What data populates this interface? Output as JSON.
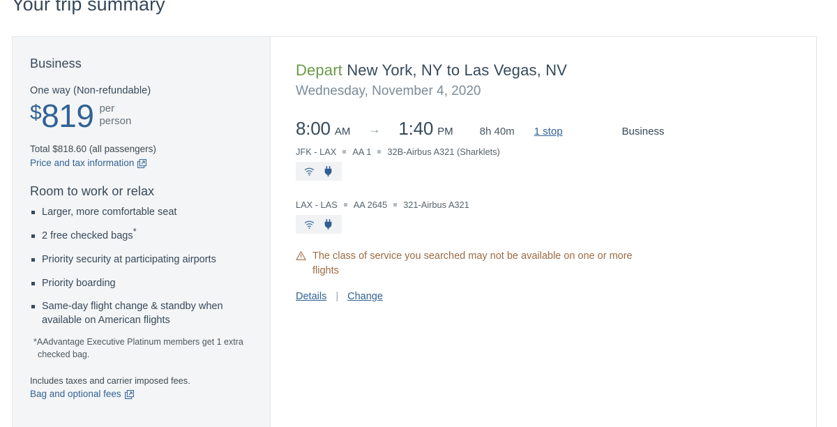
{
  "page": {
    "title": "Your trip summary"
  },
  "fare": {
    "cabin": "Business",
    "fare_type": "One way (Non-refundable)",
    "currency_symbol": "$",
    "price": "819",
    "price_unit_line1": "per",
    "price_unit_line2": "person",
    "total_line": "Total $818.60 (all passengers)",
    "tax_link": "Price and tax information",
    "tax_link_icon": "external-link-icon",
    "perks_heading": "Room to work or relax",
    "perks": [
      {
        "text": "Larger, more comfortable seat",
        "asterisk": ""
      },
      {
        "text": "2 free checked bags",
        "asterisk": "*"
      },
      {
        "text": "Priority security at participating airports",
        "asterisk": ""
      },
      {
        "text": "Priority boarding",
        "asterisk": ""
      },
      {
        "text": "Same-day flight change & standby when available on American flights",
        "asterisk": ""
      }
    ],
    "footnote": "*AAdvantage Executive Platinum members get 1 extra checked bag.",
    "fine_print": "Includes taxes and carrier imposed fees.",
    "bag_link": "Bag and optional fees",
    "bag_link_icon": "external-link-icon"
  },
  "itinerary": {
    "depart_word": "Depart",
    "route": "New York, NY to Las Vegas, NV",
    "date": "Wednesday, November 4, 2020",
    "depart_time": "8:00",
    "depart_meridiem": "AM",
    "arrow": "→",
    "arrive_time": "1:40",
    "arrive_meridiem": "PM",
    "duration": "8h 40m",
    "stops": "1 stop",
    "cabin": "Business",
    "segments": [
      {
        "route": "JFK - LAX",
        "flight_number": "AA 1",
        "aircraft": "32B-Airbus A321 (Sharklets)",
        "amenities": [
          "wifi-icon",
          "power-outlet-icon"
        ]
      },
      {
        "route": "LAX - LAS",
        "flight_number": "AA 2645",
        "aircraft": "321-Airbus A321",
        "amenities": [
          "wifi-icon",
          "power-outlet-icon"
        ]
      }
    ],
    "warning_icon": "warning-triangle-icon",
    "warning_text": "The class of service you searched may not be available on one or more flights",
    "details_link": "Details",
    "action_separator": "|",
    "change_link": "Change"
  },
  "colors": {
    "accent_blue": "#326295",
    "depart_green": "#6b9a47",
    "heading_navy": "#36495a",
    "warning_brown": "#9c6b42",
    "panel_gray": "#f4f5f6",
    "border_gray": "#e4e5e6"
  }
}
